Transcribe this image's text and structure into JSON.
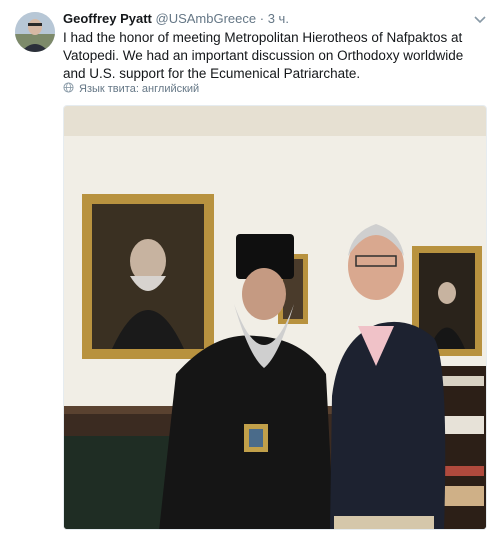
{
  "tweet": {
    "author_name": "Geoffrey Pyatt",
    "author_handle": "@USAmbGreece",
    "separator": "·",
    "time": "3 ч.",
    "text": "I had the honor of meeting Metropolitan Hierotheos of Nafpaktos at Vatopedi. We had an important discussion on Orthodoxy worldwide and U.S. support for the Ecumenical Patriarchate.",
    "translate_label": "Язык твита: английский"
  },
  "icons": {
    "avatar": "avatar",
    "caret": "chevron-down-icon",
    "globe": "globe-icon"
  },
  "colors": {
    "secondary_text": "#657786",
    "primary_text": "#14171a"
  }
}
